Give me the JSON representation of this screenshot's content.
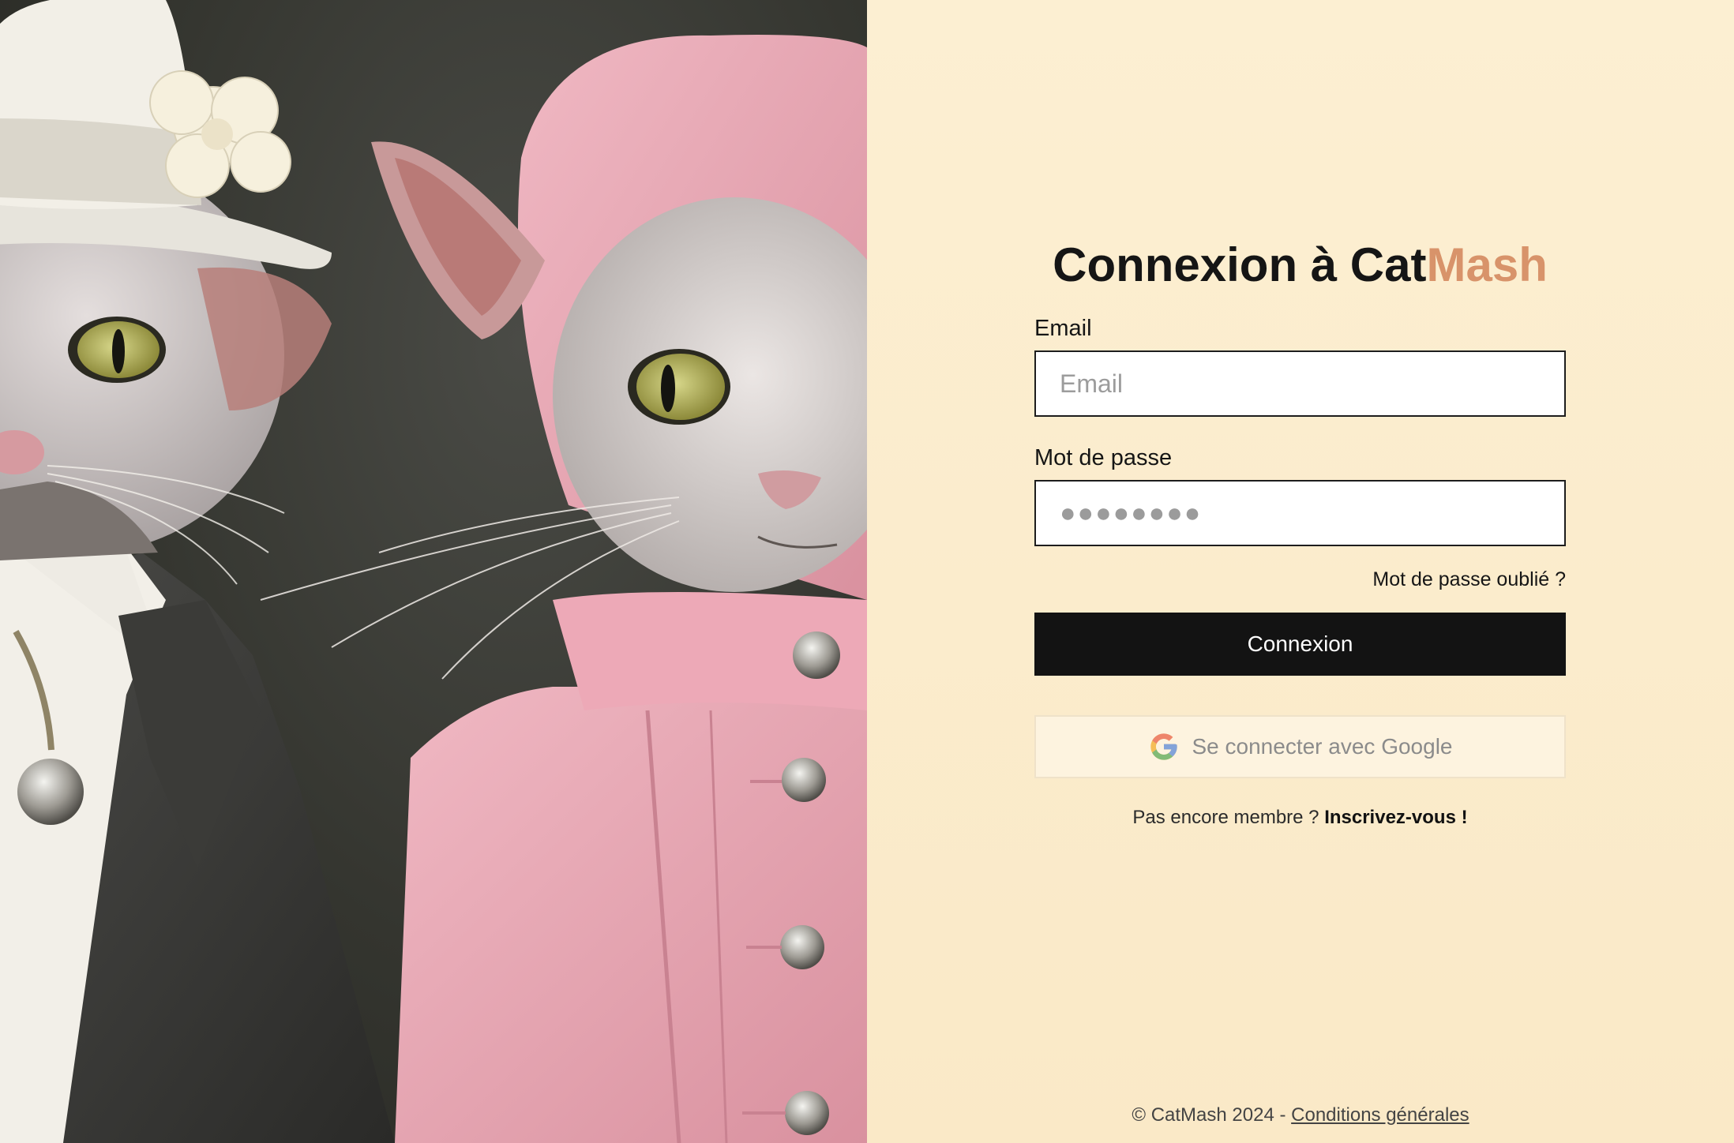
{
  "hero_image": {
    "alt": "",
    "colors": {
      "background": "#34352f",
      "pink_jacket": "#e9a9b6",
      "dark_suit": "#3c3c3a",
      "cat_fur": "#cfc9c9"
    }
  },
  "login": {
    "title_prefix": "Connexion à Cat",
    "title_brand": "Mash",
    "brand_color": "#d8936a",
    "email_label": "Email",
    "email_placeholder": "Email",
    "email_value": "",
    "password_label": "Mot de passe",
    "password_value_masked": "●●●●●●●●",
    "forgot_password": "Mot de passe oublié ?",
    "submit_label": "Connexion",
    "google_label": "Se connecter avec Google",
    "google_icon": "google-g-icon",
    "signup_prompt": "Pas encore membre ?",
    "signup_link": "Inscrivez-vous !"
  },
  "footer": {
    "copyright": "© CatMash 2024 -",
    "terms_link": "Conditions générales"
  }
}
